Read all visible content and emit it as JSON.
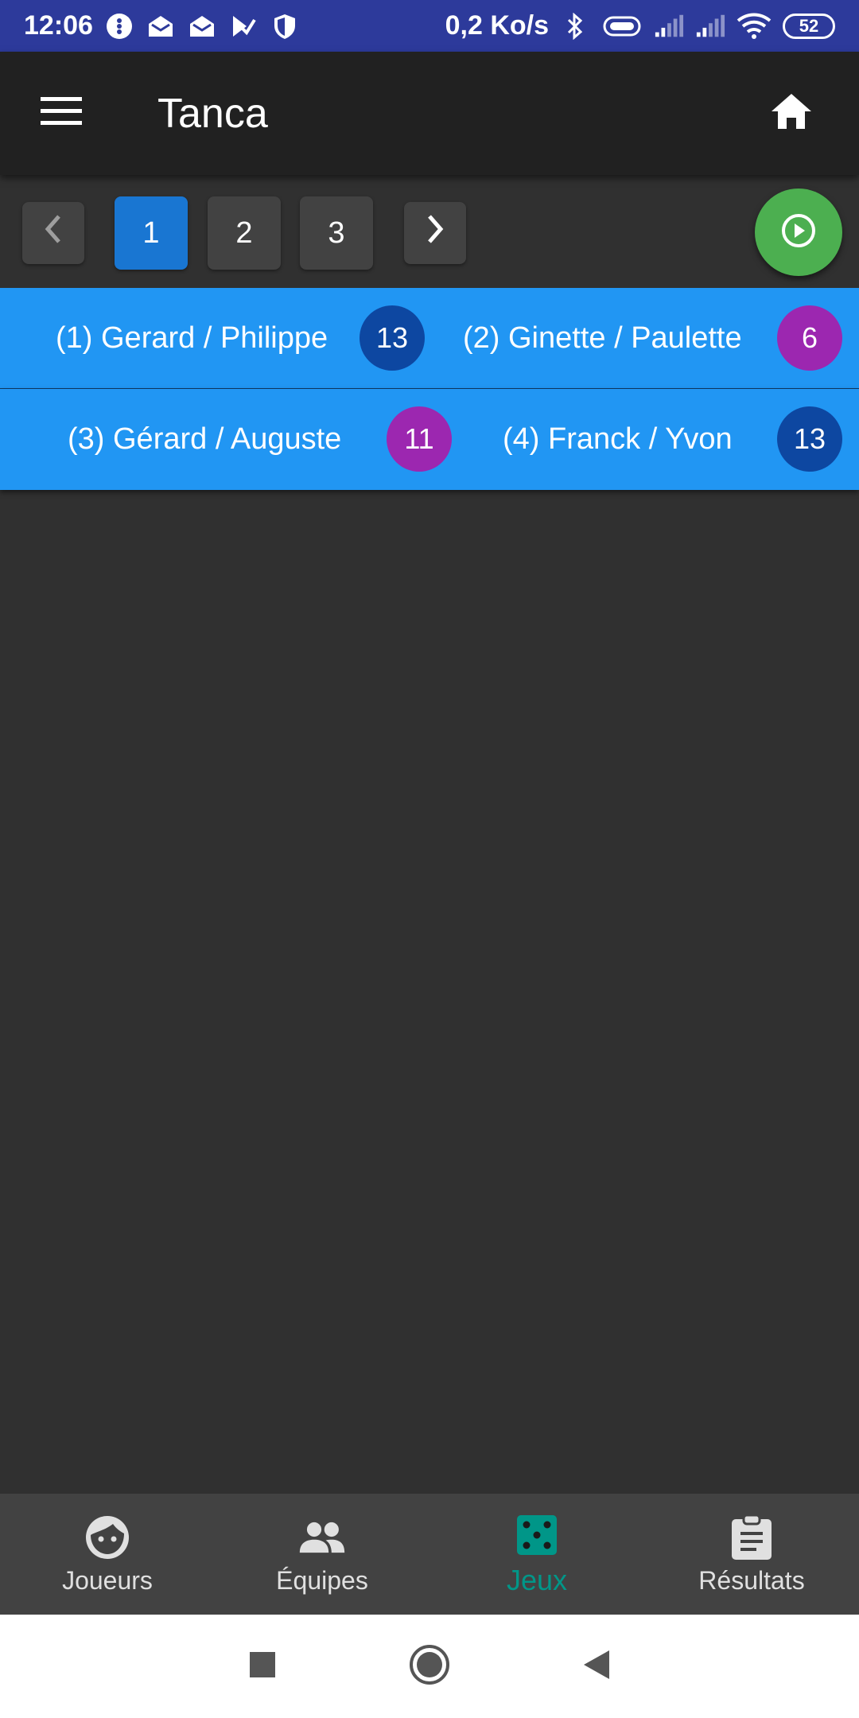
{
  "status_bar": {
    "time": "12:06",
    "net_speed": "0,2 Ko/s",
    "battery": "52"
  },
  "app_bar": {
    "title": "Tanca",
    "menu_icon": "menu-icon",
    "home_icon": "home-icon"
  },
  "pager": {
    "pages": [
      "1",
      "2",
      "3"
    ],
    "active_page": "1"
  },
  "matches": [
    {
      "team_a": {
        "label": "(1) Gerard / Philippe",
        "score": "13",
        "result": "win"
      },
      "team_b": {
        "label": "(2) Ginette / Paulette",
        "score": "6",
        "result": "lose"
      }
    },
    {
      "team_a": {
        "label": "(3) Gérard / Auguste",
        "score": "11",
        "result": "lose"
      },
      "team_b": {
        "label": "(4) Franck / Yvon",
        "score": "13",
        "result": "win"
      }
    }
  ],
  "bottom_nav": {
    "items": [
      {
        "label": "Joueurs",
        "icon": "face-icon"
      },
      {
        "label": "Équipes",
        "icon": "people-icon"
      },
      {
        "label": "Jeux",
        "icon": "dice-icon"
      },
      {
        "label": "Résultats",
        "icon": "clipboard-icon"
      }
    ],
    "active": "Jeux"
  },
  "colors": {
    "status_bar": "#2d3a9b",
    "app_bar": "#212121",
    "background": "#303030",
    "match_row": "#2196f3",
    "score_win": "#0d47a1",
    "score_lose": "#9c27b0",
    "fab": "#4caf50",
    "active_page": "#1976d2",
    "nav_active": "#009688"
  }
}
